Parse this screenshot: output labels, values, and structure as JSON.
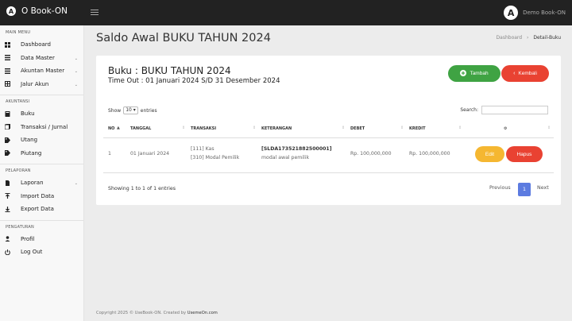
{
  "app": {
    "brand": "O Book-ON",
    "logo_letter": "A"
  },
  "topbar": {
    "user_label": "Demo Book-ON",
    "user_letter": "A"
  },
  "sidebar": {
    "main_menu_title": "MAIN MENU",
    "main_items": [
      {
        "label": "Dashboard",
        "icon": "dashboard-icon"
      },
      {
        "label": "Data Master",
        "icon": "list-icon",
        "caret": "⌄"
      },
      {
        "label": "Akuntan Master",
        "icon": "list-icon",
        "caret": "⌄"
      },
      {
        "label": "Jalur Akun",
        "icon": "grid-icon",
        "caret": "⌄"
      }
    ],
    "akuntansi_title": "AKUNTANSI",
    "akuntansi_items": [
      {
        "label": "Buku",
        "icon": "book-icon"
      },
      {
        "label": "Transaksi / Jurnal",
        "icon": "journal-icon"
      },
      {
        "label": "Utang",
        "icon": "tag-icon"
      },
      {
        "label": "Piutang",
        "icon": "tag-icon"
      }
    ],
    "pelaporan_title": "PELAPORAN",
    "pelaporan_items": [
      {
        "label": "Laporan",
        "icon": "file-icon",
        "caret": "⌄"
      },
      {
        "label": "Import Data",
        "icon": "import-icon"
      },
      {
        "label": "Export Data",
        "icon": "download-icon"
      }
    ],
    "pengaturan_title": "PENGATURAN",
    "pengaturan_items": [
      {
        "label": "Profil",
        "icon": "user-icon"
      },
      {
        "label": "Log Out",
        "icon": "power-icon"
      }
    ]
  },
  "header": {
    "title": "Saldo Awal BUKU TAHUN 2024",
    "breadcrumb_home": "Dashboard",
    "breadcrumb_sep": "›",
    "breadcrumb_current": "Detail-Buku"
  },
  "card": {
    "book_title": "Buku : BUKU TAHUN 2024",
    "timeout": "Time Out : 01 Januari 2024 S/D 31 Desember 2024",
    "add_label": "Tambah",
    "back_label": "Kembali"
  },
  "table": {
    "show_label": "Show",
    "entries_value": "10",
    "entries_label": "entries",
    "search_label": "Search:",
    "columns": [
      "NO",
      "TANGGAL",
      "TRANSAKSI",
      "KETERANGAN",
      "DEBET",
      "KREDIT",
      "⚙"
    ],
    "rows": [
      {
        "no": "1",
        "tanggal": "01 Januari 2024",
        "transaksi_1": "[111] Kas",
        "transaksi_2": "[310] Modal Pemilik",
        "keterangan_code": "[SLDA173521882500001]",
        "keterangan_text": "modal awal pemilik",
        "debet": "Rp. 100,000,000",
        "kredit": "Rp. 100,000,000",
        "edit_label": "Edit",
        "delete_label": "Hapus"
      }
    ],
    "info": "Showing 1 to 1 of 1 entries",
    "pagination": {
      "previous": "Previous",
      "page": "1",
      "next": "Next"
    }
  },
  "footer": {
    "text": "Copyright 2025 © UseBook-ON. Created by",
    "link": "UsemeOn.com"
  },
  "colors": {
    "topbar": "#222222",
    "success": "#3fa343",
    "danger": "#e94232",
    "warning": "#f5b731",
    "primary": "#5c7be0"
  }
}
